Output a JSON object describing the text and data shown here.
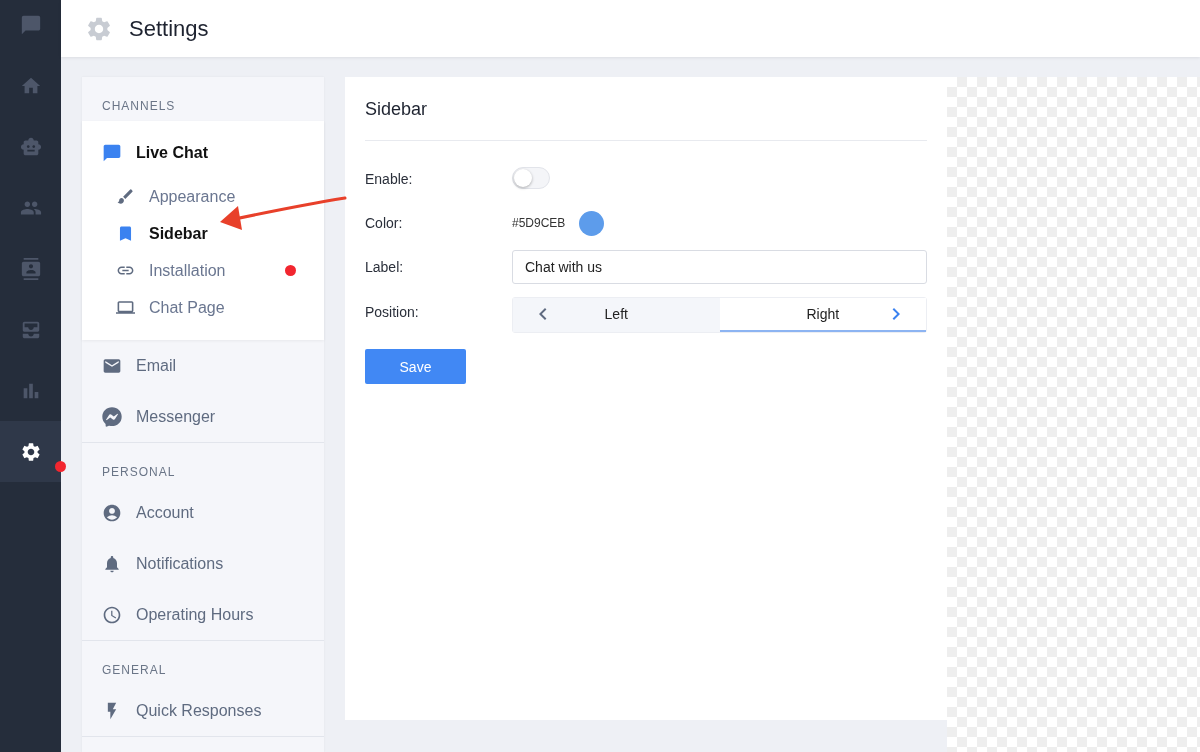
{
  "rail": {
    "items": [
      {
        "selected": false,
        "alert": false
      },
      {
        "selected": false,
        "alert": false
      },
      {
        "selected": false,
        "alert": false
      },
      {
        "selected": false,
        "alert": false
      },
      {
        "selected": false,
        "alert": false
      },
      {
        "selected": false,
        "alert": false
      },
      {
        "selected": false,
        "alert": false
      },
      {
        "selected": true,
        "alert": true
      }
    ]
  },
  "header": {
    "title": "Settings"
  },
  "nav": {
    "sections": [
      {
        "heading": "CHANNELS",
        "items": [
          {
            "label": "Live Chat",
            "expanded": true,
            "alert": false,
            "children": [
              {
                "label": "Appearance",
                "selected": false,
                "alert": false
              },
              {
                "label": "Sidebar",
                "selected": true,
                "alert": false
              },
              {
                "label": "Installation",
                "selected": false,
                "alert": true
              },
              {
                "label": "Chat Page",
                "selected": false,
                "alert": false
              }
            ]
          },
          {
            "label": "Email",
            "expanded": false,
            "alert": false
          },
          {
            "label": "Messenger",
            "expanded": false,
            "alert": false
          }
        ]
      },
      {
        "heading": "PERSONAL",
        "items": [
          {
            "label": "Account",
            "expanded": false,
            "alert": false
          },
          {
            "label": "Notifications",
            "expanded": false,
            "alert": false
          },
          {
            "label": "Operating Hours",
            "expanded": false,
            "alert": false
          }
        ]
      },
      {
        "heading": "GENERAL",
        "items": [
          {
            "label": "Quick Responses",
            "expanded": false,
            "alert": false
          }
        ]
      }
    ]
  },
  "panel": {
    "title": "Sidebar",
    "fields": [
      {
        "kind": "toggle",
        "label": "Enable:",
        "on": false
      },
      {
        "kind": "color",
        "label": "Color:",
        "value": "#5D9CEB",
        "color": "#5d9ceb"
      },
      {
        "kind": "text",
        "label": "Label:",
        "value": "Chat with us"
      },
      {
        "kind": "segmented",
        "label": "Position:",
        "options": [
          {
            "label": "Left",
            "selected": false
          },
          {
            "label": "Right",
            "selected": true
          }
        ]
      }
    ],
    "save_button": "Save"
  }
}
